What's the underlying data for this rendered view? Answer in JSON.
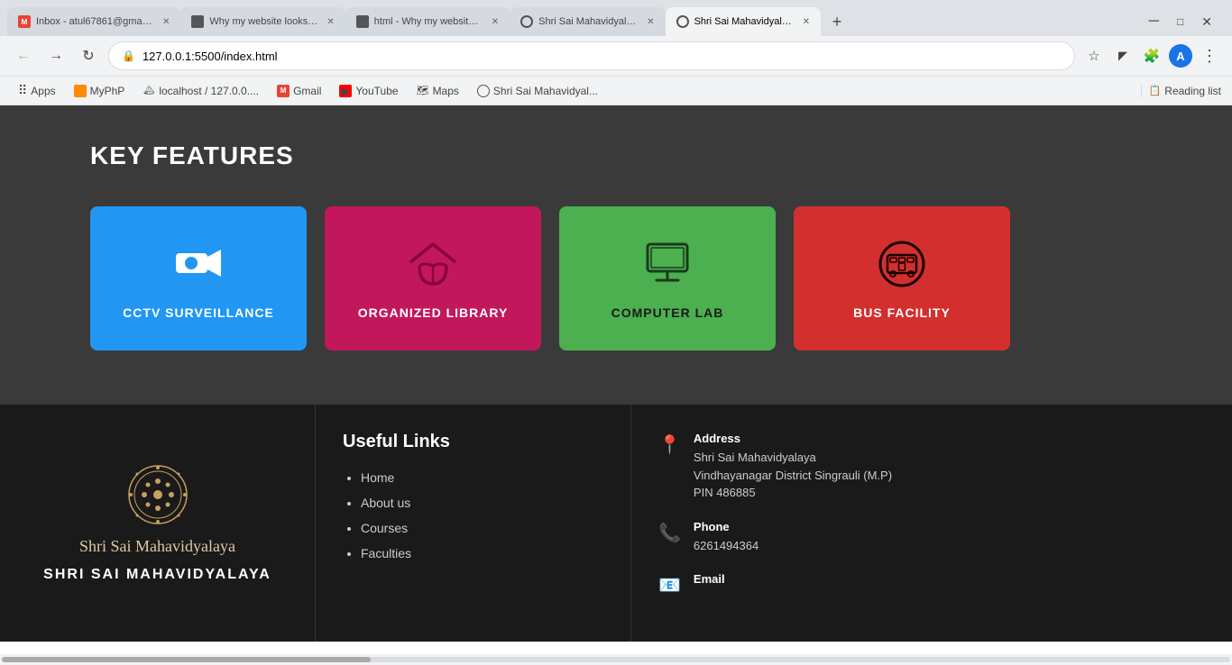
{
  "browser": {
    "tabs": [
      {
        "label": "Inbox - atul67861@gmail.c...",
        "favicon_color": "#EA4335",
        "favicon_letter": "M",
        "active": false,
        "id": "tab-inbox"
      },
      {
        "label": "Why my website looks differe...",
        "favicon_color": "#fff",
        "active": false,
        "id": "tab-why1"
      },
      {
        "label": "html - Why my website foote...",
        "favicon_color": "#fff",
        "active": false,
        "id": "tab-why2"
      },
      {
        "label": "Shri Sai Mahavidyalaya",
        "favicon_color": "#333",
        "active": false,
        "id": "tab-sai1"
      },
      {
        "label": "Shri Sai Mahavidyalaya",
        "favicon_color": "#333",
        "active": true,
        "id": "tab-sai2"
      }
    ],
    "url": "127.0.0.1:5500/index.html",
    "bookmarks": [
      {
        "label": "Apps",
        "id": "bm-apps"
      },
      {
        "label": "MyPhP",
        "id": "bm-myphp"
      },
      {
        "label": "localhost / 127.0.0....",
        "id": "bm-localhost"
      },
      {
        "label": "Gmail",
        "id": "bm-gmail"
      },
      {
        "label": "YouTube",
        "id": "bm-youtube"
      },
      {
        "label": "Maps",
        "id": "bm-maps"
      },
      {
        "label": "Shri Sai Mahavidyal...",
        "id": "bm-sai"
      }
    ],
    "reading_list_label": "Reading list"
  },
  "key_features": {
    "title": "KEY FEATURES",
    "cards": [
      {
        "id": "cctv",
        "label": "CCTV SURVEILLANCE",
        "color": "blue"
      },
      {
        "id": "library",
        "label": "ORGANIZED LIBRARY",
        "color": "pink"
      },
      {
        "id": "computer",
        "label": "COMPUTER LAB",
        "color": "green"
      },
      {
        "id": "bus",
        "label": "BUS FACILITY",
        "color": "red"
      }
    ]
  },
  "footer": {
    "logo_alt": "Shri Sai Mahavidyalaya Logo",
    "school_name_script": "Shri Sai Mahavidyalaya",
    "school_name_bold": "SHRI SAI MAHAVIDYALAYA",
    "useful_links_title": "Useful Links",
    "links": [
      {
        "label": "Home",
        "id": "link-home"
      },
      {
        "label": "About us",
        "id": "link-about"
      },
      {
        "label": "Courses",
        "id": "link-courses"
      },
      {
        "label": "Faculties",
        "id": "link-faculties"
      }
    ],
    "address_title": "Address",
    "address_line1": "Shri Sai Mahavidyalaya",
    "address_line2": "Vindhayanagar District Singrauli (M.P)",
    "address_line3": "PIN 486885",
    "phone_title": "Phone",
    "phone": "6261494364",
    "email_title": "Email"
  }
}
